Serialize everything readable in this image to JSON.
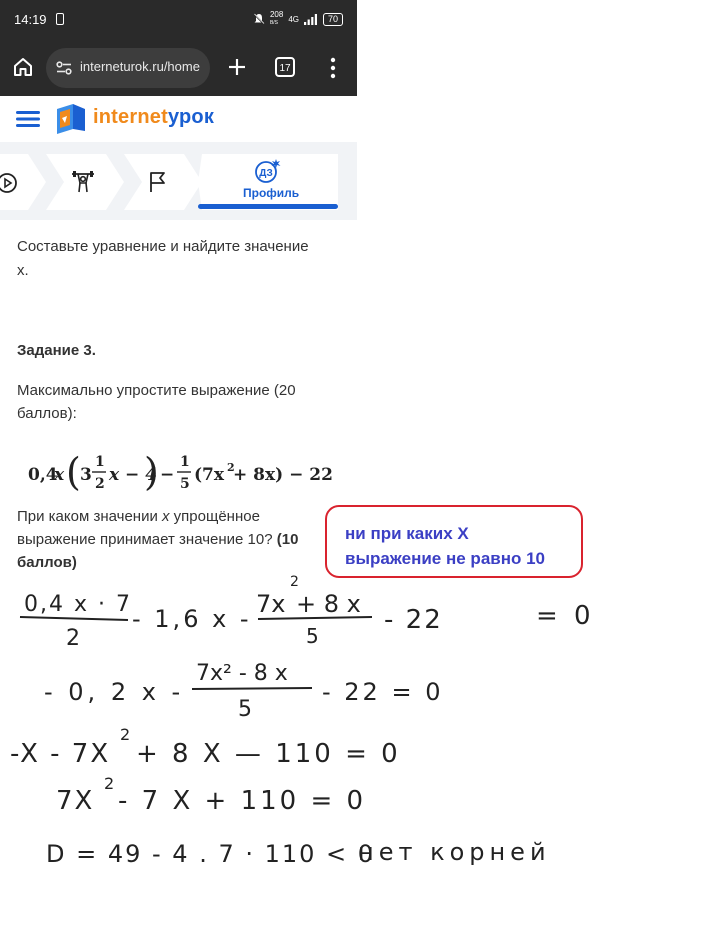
{
  "status_bar": {
    "time": "14:19",
    "net_speed": "208",
    "net_speed_unit": "B/S",
    "network": "4G",
    "battery": "70"
  },
  "browser": {
    "url": "interneturok.ru/home",
    "tab_count": "17"
  },
  "site": {
    "logo_part1": "internet",
    "logo_part2": "урок",
    "colors": {
      "orange": "#f08a1c",
      "blue": "#1a5fd1"
    }
  },
  "tabs": {
    "profile_badge": "ДЗ",
    "profile_label": "Профиль"
  },
  "content": {
    "line1": "Составьте уравнение и найдите значение",
    "line2": "х.",
    "task_title": "Задание 3.",
    "simplify_1": "Максимально упростите выражение (20",
    "simplify_2": "баллов):",
    "formula": {
      "a": "0,4",
      "x": "x",
      "whole": "3",
      "num1": "1",
      "den1": "2",
      "minus4": "x − 4",
      "minus": "−",
      "num2": "1",
      "den2": "5",
      "inner": "(7x",
      "sq": "2",
      "rest": " + 8x) − 22"
    },
    "question_1a": "При каком значении ",
    "question_1b": "x",
    "question_1c": " упрощённое",
    "question_2a": "выражение принимает значение 10? ",
    "question_2b": "(10",
    "question_3": "баллов)"
  },
  "annotation": {
    "line1": "ни при каких Х",
    "line2": "выражение не равно 10",
    "border_color": "#d9232e",
    "text_color": "#3b3fc4"
  },
  "handwriting": {
    "l1_num": "0,4 x · 7",
    "l1_den": "2",
    "l1_mid": "- 1,6 x -",
    "l1_frac_num": "7x",
    "l1_frac_exp": "2",
    "l1_frac_rest": " + 8 x",
    "l1_frac_den": "5",
    "l1_tail": "- 22",
    "l1_eq": "= 0",
    "l2_start": "- 0, 2 x -",
    "l2_frac_num": "7x² - 8 x",
    "l2_frac_den": "5",
    "l2_tail": "- 22 = 0",
    "l3_a": "-X - 7X",
    "l3_exp": "2",
    "l3_b": "+ 8 X — 110 = 0",
    "l4_a": "7X",
    "l4_exp": "2",
    "l4_b": "- 7 X + 110 = 0",
    "l5": "D = 49 - 4 . 7 · 110 < 0",
    "l5_words": "нет корней"
  }
}
